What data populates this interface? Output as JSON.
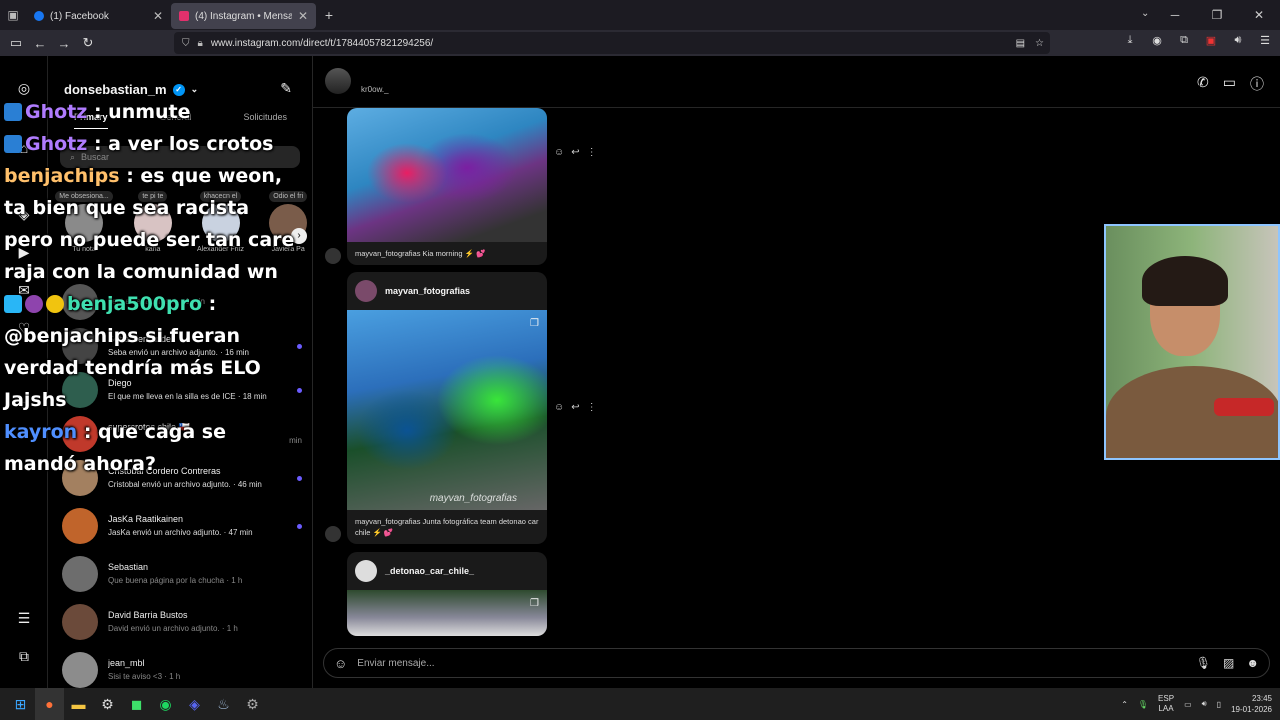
{
  "browser": {
    "tabs": [
      {
        "title": "(1) Facebook",
        "favicon_color": "#1877f2"
      },
      {
        "title": "(4) Instagram • Mensajes",
        "favicon_color": "#e1306c"
      }
    ],
    "new_tab": "+",
    "url": "www.instagram.com/direct/t/17844057821294256/"
  },
  "inbox": {
    "username": "donsebastian_m",
    "tabs": [
      "Primary",
      "General",
      "Solicitudes"
    ],
    "search_placeholder": "Buscar",
    "notes": [
      {
        "bubble": "Me obsesiona...",
        "name": "Tu nota"
      },
      {
        "bubble": "te pi te",
        "name": "karla"
      },
      {
        "bubble": "khacecn el",
        "name": "Alexander Fritz"
      },
      {
        "bubble": "Odio el fri",
        "name": "Javiera Pa"
      }
    ],
    "conversations": [
      {
        "name": "",
        "preview": "sent an attachment. · 1 min",
        "unread": false
      },
      {
        "name": "Seba Hernández",
        "preview": "Seba envió un archivo adjunto. · 16 min",
        "unread": true
      },
      {
        "name": "Diego",
        "preview": "El que me lleva en la silla es de ICE · 18 min",
        "unread": true
      },
      {
        "name": "supercrotos chile 🇨🇱",
        "preview": "min",
        "unread": false
      },
      {
        "name": "Cristobal Cordero Contreras",
        "preview": "Cristobal envió un archivo adjunto. · 46 min",
        "unread": true
      },
      {
        "name": "JasKa Raatikainen",
        "preview": "JasKa envió un archivo adjunto. · 47 min",
        "unread": true
      },
      {
        "name": "Sebastian",
        "preview": "Que buena página por la chucha · 1 h",
        "unread": false
      },
      {
        "name": "David Barria Bustos",
        "preview": "David envió un archivo adjunto. · 1 h",
        "unread": false
      },
      {
        "name": "jean_mbl",
        "preview": "Sisi te aviso <3 · 1 h",
        "unread": false
      }
    ]
  },
  "chat": {
    "contact": "kr0ow._",
    "posts": [
      {
        "author": "",
        "caption": "mayvan_fotografias Kia morning ⚡ 💕"
      },
      {
        "author": "mayvan_fotografias",
        "caption": "mayvan_fotografias Junta fotográfica team detonao car chile ⚡ 💕",
        "watermark": "mayvan_fotografias"
      },
      {
        "author": "_detonao_car_chile_",
        "caption": ""
      }
    ],
    "composer_placeholder": "Enviar mensaje..."
  },
  "stream_chat": [
    {
      "user": "Ghotz",
      "text": ": unmute"
    },
    {
      "user": "Ghotz",
      "text": ": a ver los crotos"
    },
    {
      "user": "benjachips",
      "text": ": es que weon, ta bien que sea racista pero no puede ser tan care raja con la comunidad wn"
    },
    {
      "user": "benja500pro",
      "text": ": @benjachips si fueran verdad tendría más ELO Jajshs"
    },
    {
      "user": "kayron",
      "text": ": que caga se mandó ahora?"
    }
  ],
  "taskbar": {
    "lang_top": "ESP",
    "lang_bottom": "LAA",
    "time": "23:45",
    "date": "19-01-2026"
  }
}
